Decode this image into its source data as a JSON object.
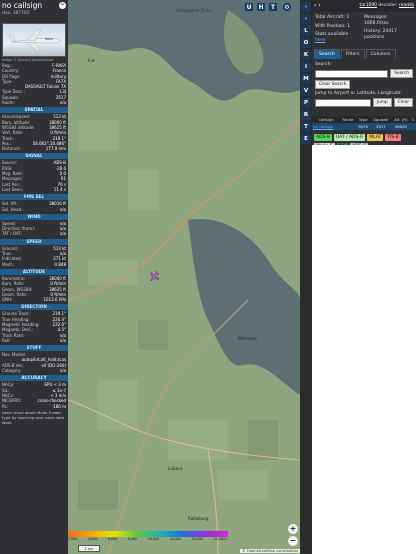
{
  "aircraft": {
    "callsign": "no callsign",
    "hex": "Hex: 38776D",
    "photo_credit": "Image © Dzmitrij Kamashanski",
    "info": [
      {
        "k": "Reg.:",
        "v": "F-RAFA"
      },
      {
        "k": "Country:",
        "v": "France"
      },
      {
        "k": "DB flags:",
        "v": "military"
      },
      {
        "k": "Type:",
        "v": "FA7X"
      },
      {
        "k": "",
        "v": "DASSAULT Falcon 7X"
      },
      {
        "k": "Type Desc.:",
        "v": "L3J"
      },
      {
        "k": "Squawk:",
        "v": "3517"
      },
      {
        "k": "Route:",
        "v": "n/a"
      }
    ],
    "sections": [
      {
        "title": "SPATIAL",
        "rows": [
          {
            "k": "Groundspeed:",
            "v": "513 kt"
          },
          {
            "k": "Baro. altitude:",
            "v": "38000 ft"
          },
          {
            "k": "WGS84 altitude:",
            "v": "38625 ft"
          },
          {
            "k": "Vert. Rate:",
            "v": "0 ft/min"
          },
          {
            "k": "Track:",
            "v": "219.1°"
          },
          {
            "k": "Pos.:",
            "v": "54.062°,10.486°"
          },
          {
            "k": "Distance:",
            "v": "177.9 nmi"
          }
        ]
      },
      {
        "title": "SIGNAL",
        "rows": [
          {
            "k": "Source:",
            "v": "ADS-B"
          },
          {
            "k": "RSSI:",
            "v": "-28.6"
          },
          {
            "k": "Msg. Rate:",
            "v": "0.0"
          },
          {
            "k": "Messages:",
            "v": "61"
          },
          {
            "k": "Last Pos.:",
            "v": "76 s"
          },
          {
            "k": "Last Seen:",
            "v": "11.4 s"
          }
        ]
      },
      {
        "title": "FMS SEL",
        "rows": [
          {
            "k": "Sel. Alt.:",
            "v": "38016 ft"
          },
          {
            "k": "Sel. Head.:",
            "v": "n/a"
          }
        ]
      },
      {
        "title": "WIND",
        "rows": [
          {
            "k": "Speed:",
            "v": "n/a"
          },
          {
            "k": "Direction (from):",
            "v": "n/a"
          },
          {
            "k": "TAT / OAT:",
            "v": "n/a"
          }
        ]
      },
      {
        "title": "SPEED",
        "rows": [
          {
            "k": "Ground:",
            "v": "513 kt"
          },
          {
            "k": "True:",
            "v": "n/a"
          },
          {
            "k": "Indicated:",
            "v": "271 kt"
          },
          {
            "k": "Mach:",
            "v": "0.848"
          }
        ]
      },
      {
        "title": "ALTITUDE",
        "rows": [
          {
            "k": "Barometric:",
            "v": "38000 ft"
          },
          {
            "k": "Baro. Rate:",
            "v": "0 ft/min"
          },
          {
            "k": "Geom. WGS84:",
            "v": "38625 ft"
          },
          {
            "k": "Geom. Rate:",
            "v": "0 ft/min"
          },
          {
            "k": "QNH:",
            "v": "1013.6 hPa"
          }
        ]
      },
      {
        "title": "DIRECTION",
        "rows": [
          {
            "k": "Ground Track:",
            "v": "219.1°"
          },
          {
            "k": "True Heading:",
            "v": "226.4°"
          },
          {
            "k": "Magnetic Heading:",
            "v": "222.0°"
          },
          {
            "k": "Magnetic Decl.:",
            "v": "4.5°"
          },
          {
            "k": "Track Rate:",
            "v": "n/a"
          },
          {
            "k": "Roll:",
            "v": "n/a"
          }
        ]
      },
      {
        "title": "STUFF",
        "rows": [
          {
            "k": "Nav. Modes:",
            "v": ""
          },
          {
            "k": "",
            "v": "autopilot,alt_hold,tcas"
          },
          {
            "k": "ADS-B Ver.:",
            "v": "v0 (DO-260)"
          },
          {
            "k": "Category:",
            "v": "n/a"
          }
        ]
      },
      {
        "title": "ACCURACY",
        "rows": [
          {
            "k": "NACp:",
            "v": "EPU < 3 m"
          },
          {
            "k": "SIL:",
            "v": "≤ 1e-7"
          },
          {
            "k": "NACv:",
            "v": "< 3 m/s"
          },
          {
            "k": "NICBARO:",
            "v": "cross-checked"
          },
          {
            "k": "Rc:",
            "v": "186 m"
          }
        ]
      }
    ],
    "footer_note": "Learn more about Mode S data type by hovering over each data label."
  },
  "map": {
    "labels": {
      "sea_title": "Grossglaser Fjohs",
      "city1": "Lübeck",
      "city2": "Ratzeburg",
      "city3": "Kiel",
      "city4": "Wismarer"
    },
    "top_buttons": [
      "U",
      "H",
      "T"
    ],
    "zoom_in": "+",
    "zoom_out": "−",
    "scale": "1 km",
    "attribution": "© OpenStreetMap contributors",
    "legend_ticks": [
      "2,000",
      "4,000",
      "6,000",
      "8,000",
      "10,000",
      "20,000",
      "30,000",
      "40,000+"
    ]
  },
  "side_buttons": [
    "L",
    "O",
    "K",
    "I",
    "M",
    "V",
    "P",
    "R",
    "T",
    "E"
  ],
  "right_panel": {
    "nav": "‹ ›",
    "site": "tar1090",
    "decoder_text": "decoder:",
    "decoder_status": "readsb",
    "total_aircraft": "Total Aircraft: 1",
    "with_position": "With Position: 1",
    "messages": "Messages: 1866.0/sec",
    "history": "History: 24417 positions",
    "stats_available": "Stats available",
    "stats_link": "here",
    "tabs": [
      "Search",
      "Filters",
      "Columns"
    ],
    "search_label": "Search:",
    "search_btn": "Search",
    "clear_search_btn": "Clear Search",
    "jump_label": "Jump to Airport or Latitude, Longitude:",
    "jump_btn": "Jump",
    "clear_btn": "Clear",
    "table_headers": [
      "Callsign",
      "Route",
      "Type",
      "Squawk",
      "Alt. (ft)",
      "S"
    ],
    "table_rows": [
      [
        "no callsign",
        "",
        "FA7X",
        "3517",
        "38000",
        ""
      ]
    ],
    "chips": [
      {
        "label": "ADS-B",
        "color": "#5bd35b"
      },
      {
        "label": "UAT / ADS-R",
        "color": "#b9e8b9"
      },
      {
        "label": "MLAT",
        "color": "#f2c35b"
      },
      {
        "label": "TIS-B",
        "color": "#f27e7e"
      },
      {
        "label": "Mode-S",
        "color": "#d8d8d8"
      },
      {
        "label": "AIS",
        "color": "#3a8a3a"
      },
      {
        "label": "ADS-C",
        "color": "#a6d0ea"
      }
    ]
  }
}
